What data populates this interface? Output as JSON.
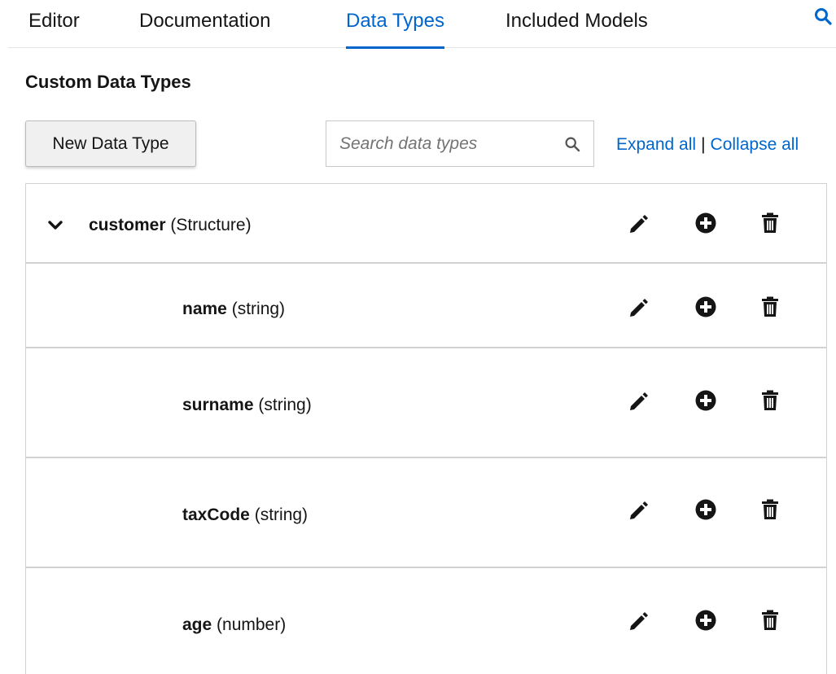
{
  "tabs": [
    {
      "label": "Editor",
      "active": false
    },
    {
      "label": "Documentation",
      "active": false
    },
    {
      "label": "Data Types",
      "active": true
    },
    {
      "label": "Included Models",
      "active": false
    }
  ],
  "section_title": "Custom Data Types",
  "toolbar": {
    "new_button_label": "New Data Type",
    "search_placeholder": "Search data types",
    "expand_all_label": "Expand all",
    "separator": "|",
    "collapse_all_label": "Collapse all"
  },
  "rows": [
    {
      "name": "customer",
      "type": "(Structure)",
      "expanded": true
    },
    {
      "name": "name",
      "type": "(string)"
    },
    {
      "name": "surname",
      "type": "(string)"
    },
    {
      "name": "taxCode",
      "type": "(string)"
    },
    {
      "name": "age",
      "type": "(number)"
    }
  ],
  "icons": {
    "top_search": "search-icon",
    "row_actions": [
      "pencil-icon",
      "plus-circle-icon",
      "trash-icon"
    ]
  },
  "colors": {
    "accent": "#0066cc",
    "text": "#151515",
    "border": "#d2d2d2"
  }
}
